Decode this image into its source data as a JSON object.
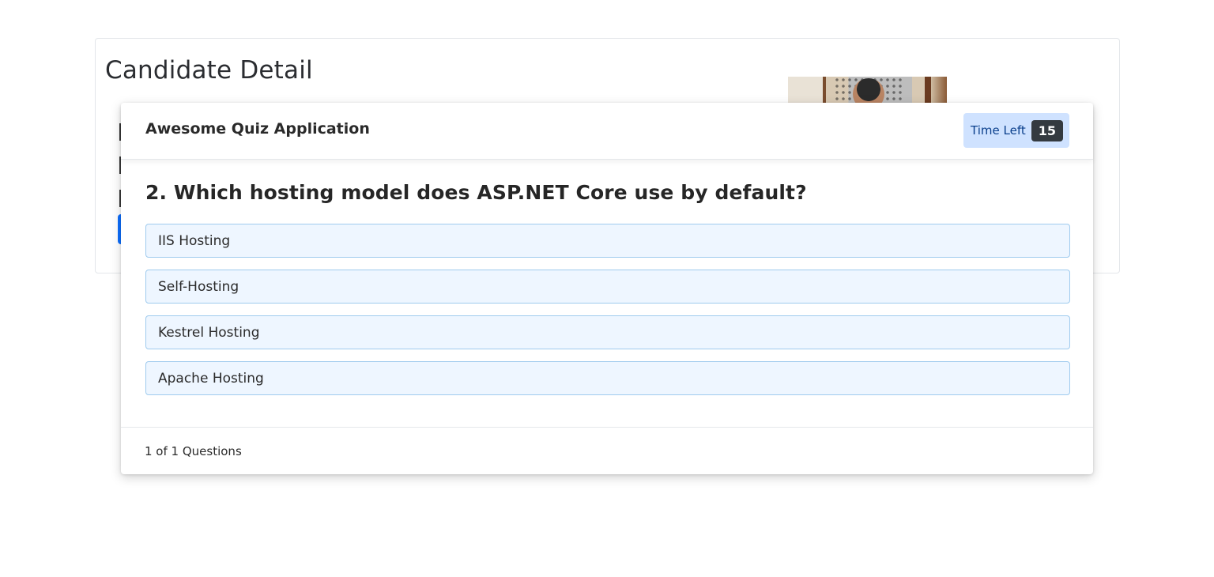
{
  "candidate": {
    "title": "Candidate Detail"
  },
  "quiz": {
    "app_title": "Awesome Quiz Application",
    "timer_label": "Time Left",
    "timer_value": "15",
    "question": "2. Which hosting model does ASP.NET Core use by default?",
    "options": [
      {
        "label": "IIS Hosting"
      },
      {
        "label": "Self-Hosting"
      },
      {
        "label": "Kestrel Hosting"
      },
      {
        "label": "Apache Hosting"
      }
    ],
    "progress": "1 of 1 Questions"
  },
  "colors": {
    "timer_bg": "#cfe2ff",
    "timer_badge": "#343a40",
    "option_bg": "#eef6ff",
    "option_border": "#9fcbee",
    "primary": "#0d6efd"
  }
}
